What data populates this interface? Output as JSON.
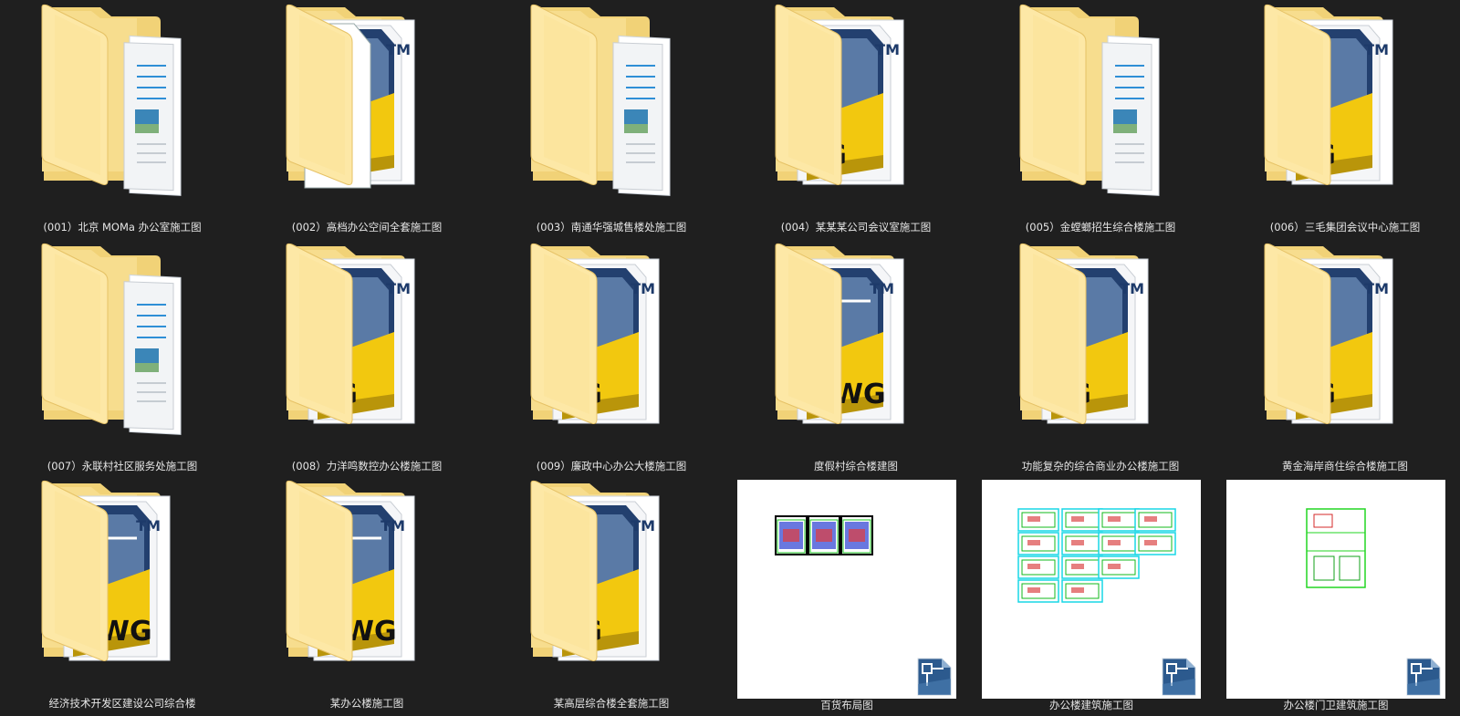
{
  "folders": [
    {
      "label": "(001）北京 MOMa 办公室施工图",
      "style": "docs"
    },
    {
      "label": "(002）高档办公空间全套施工图",
      "style": "dwg-blank"
    },
    {
      "label": "(003）南通华强城售楼处施工图",
      "style": "docs"
    },
    {
      "label": "(004）某某某公司会议室施工图",
      "style": "dwg"
    },
    {
      "label": "(005）金螳螂招生综合楼施工图",
      "style": "docs"
    },
    {
      "label": "(006）三毛集团会议中心施工图",
      "style": "dwg"
    },
    {
      "label": "(007）永联村社区服务处施工图",
      "style": "docs"
    },
    {
      "label": "(008）力洋鸣数控办公楼施工图",
      "style": "dwg"
    },
    {
      "label": "(009）廉政中心办公大楼施工图",
      "style": "dwg"
    },
    {
      "label": "度假村综合楼建图",
      "style": "dwg-big"
    },
    {
      "label": "功能复杂的综合商业办公楼施工图",
      "style": "dwg"
    },
    {
      "label": "黄金海岸商住综合楼施工图",
      "style": "dwg"
    },
    {
      "label": "经济技术开发区建设公司综合楼",
      "style": "dwg-big"
    },
    {
      "label": "某办公楼施工图",
      "style": "dwg-big"
    },
    {
      "label": "某高层综合楼全套施工图",
      "style": "dwg"
    }
  ],
  "files": [
    {
      "label": "百货布局图",
      "preview": "three-sheets"
    },
    {
      "label": "办公楼建筑施工图",
      "preview": "many-sheets"
    },
    {
      "label": "办公楼门卫建筑施工图",
      "preview": "single-sheet"
    }
  ],
  "icons": {
    "folder": "folder-icon",
    "dwg_file": "dwg-file-icon"
  },
  "dwg_text": "DWG",
  "tm_text": "TM",
  "colors": {
    "background": "#1f1f1f",
    "folder_light": "#fde8a6",
    "folder_dark": "#f4cf69",
    "dwg_yellow": "#f2c80f",
    "dwg_navy": "#1d3a6a"
  }
}
